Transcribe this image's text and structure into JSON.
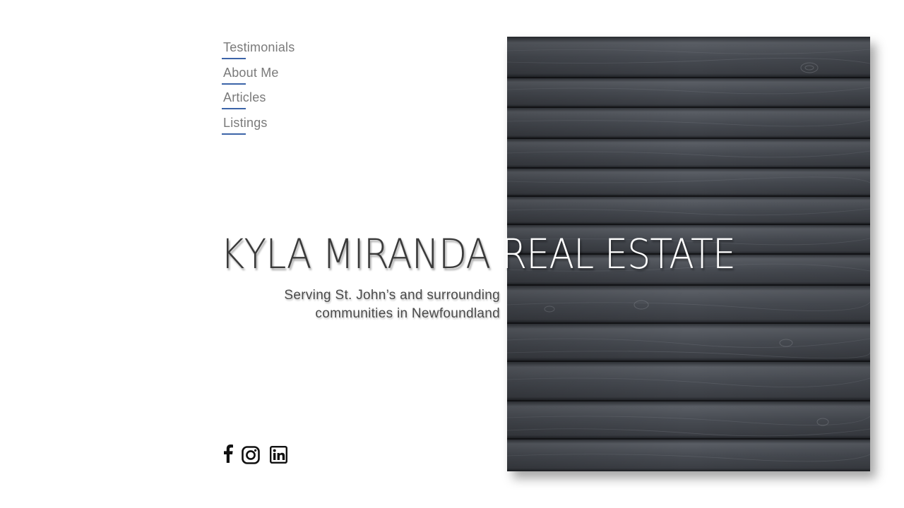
{
  "nav": {
    "items": [
      {
        "label": "Testimonials"
      },
      {
        "label": "About Me"
      },
      {
        "label": "Articles"
      },
      {
        "label": "Listings"
      }
    ],
    "underline_color": "#3c64a8"
  },
  "hero": {
    "title_dark": "KYLA MIRANDA",
    "title_light": "REAL ESTATE",
    "subtitle_line1": "Serving St. John’s and surrounding",
    "subtitle_line2": "communities in Newfoundland"
  },
  "social": {
    "icons": [
      "facebook-icon",
      "instagram-icon",
      "linkedin-icon"
    ]
  },
  "colors": {
    "background": "#ffffff",
    "wood_panel": "#3e4147",
    "nav_text": "#7a7a7a",
    "title_dark": "#3a3a3a"
  }
}
